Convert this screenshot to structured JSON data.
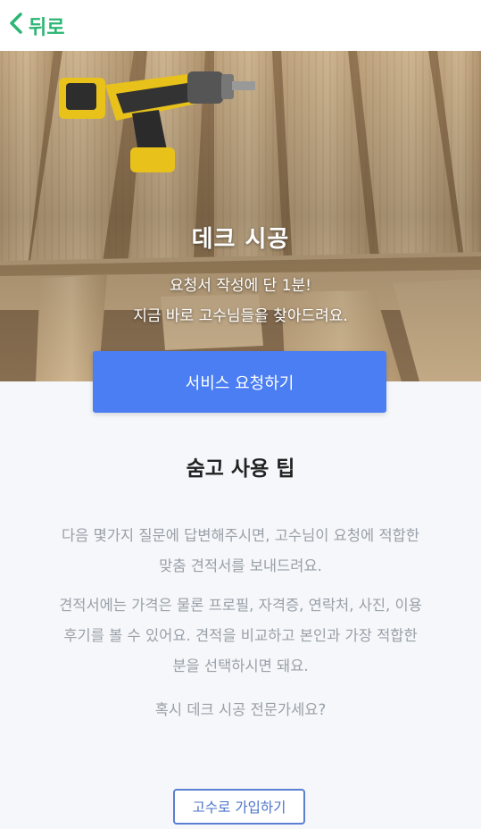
{
  "header": {
    "back_label": "뒤로",
    "accent_color": "#2bb673"
  },
  "hero": {
    "title": "데크 시공",
    "subtitle_line1": "요청서 작성에 단 1분!",
    "subtitle_line2": "지금 바로 고수님들을 찾아드려요."
  },
  "request_button": {
    "label": "서비스 요청하기",
    "color": "#4a7ef2"
  },
  "tips": {
    "title": "숨고 사용 팁",
    "paragraph1_line1": "다음 몇가지 질문에 답변해주시면, 고수님이 요청에 적합한",
    "paragraph1_line2": "맞춤 견적서를 보내드려요.",
    "paragraph2_line1": "견적서에는 가격은 물론 프로필, 자격증, 연락처, 사진, 이용",
    "paragraph2_line2": "후기를 볼 수 있어요. 견적을 비교하고 본인과 가장 적합한",
    "paragraph2_line3": "분을 선택하시면 돼요.",
    "question": "혹시 데크 시공 전문가세요?"
  },
  "signup_button": {
    "label": "고수로 가입하기"
  }
}
